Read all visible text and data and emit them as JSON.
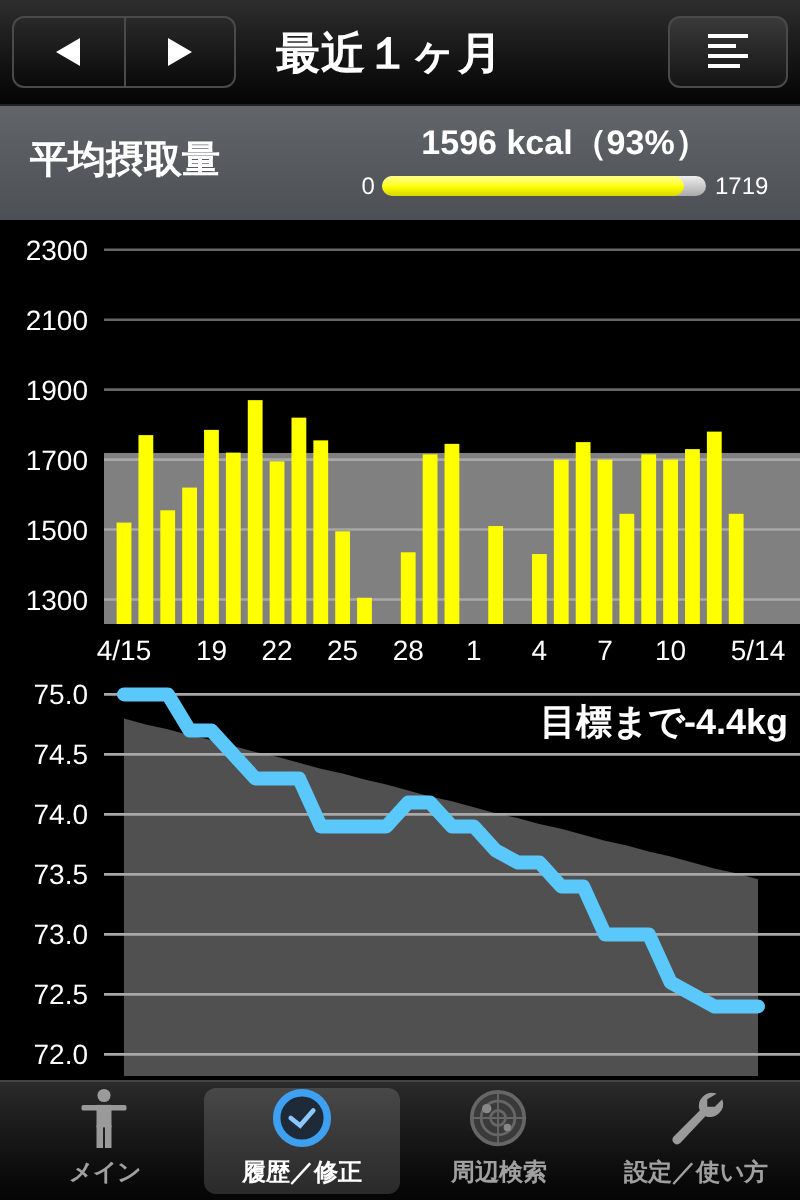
{
  "header": {
    "title": "最近１ヶ月"
  },
  "summary": {
    "label": "平均摂取量",
    "value": "1596 kcal（93%）",
    "min": "0",
    "max": "1719",
    "level": 0.93
  },
  "intake_chart": {
    "chart_data": {
      "type": "bar",
      "categories": [
        "4/15",
        null,
        null,
        null,
        "19",
        null,
        null,
        "22",
        null,
        null,
        "25",
        null,
        null,
        "28",
        null,
        null,
        "1",
        null,
        null,
        "4",
        null,
        null,
        "7",
        null,
        null,
        "10",
        null,
        null,
        null,
        "5/14"
      ],
      "series": [
        {
          "color": "#ffff00",
          "values": [
            1520,
            1770,
            1555,
            1620,
            1785,
            1720,
            1870,
            1695,
            1820,
            1755,
            1495,
            1305,
            null,
            1435,
            1715,
            1745,
            null,
            1510,
            null,
            1430,
            1700,
            1750,
            1700,
            1545,
            1715,
            1700,
            1730,
            1780,
            1545,
            null
          ]
        }
      ],
      "ylim": [
        1230,
        2385
      ],
      "yticks": [
        1300,
        1500,
        1700,
        1900,
        2100,
        2300
      ],
      "grid": true,
      "bands": [
        {
          "axis": "y",
          "from": 1230,
          "to": 1719,
          "color": "#808080"
        }
      ]
    }
  },
  "weight_chart": {
    "goal_text": "目標まで-4.4kg",
    "chart_data": {
      "type": "line",
      "categories": [
        null,
        null,
        null,
        null,
        null,
        null,
        null,
        null,
        null,
        null,
        null,
        null,
        null,
        null,
        null,
        null,
        null,
        null,
        null,
        null,
        null,
        null,
        null,
        null,
        null,
        null,
        null,
        null,
        null,
        null
      ],
      "series": [
        {
          "type": "area",
          "color": "#505050",
          "values": [
            74.8,
            74.75,
            74.71,
            74.66,
            74.62,
            74.57,
            74.52,
            74.48,
            74.43,
            74.38,
            74.34,
            74.29,
            74.25,
            74.2,
            74.15,
            74.11,
            74.06,
            74.01,
            73.97,
            73.92,
            73.88,
            73.83,
            73.78,
            73.74,
            73.69,
            73.65,
            73.6,
            73.55,
            73.51,
            73.46
          ]
        },
        {
          "type": "line",
          "color": "#5ac8fa",
          "values": [
            75.0,
            75.0,
            75.0,
            74.7,
            74.7,
            74.5,
            74.3,
            74.3,
            74.3,
            73.9,
            73.9,
            73.9,
            73.9,
            74.1,
            74.1,
            73.9,
            73.9,
            73.7,
            73.6,
            73.6,
            73.4,
            73.4,
            73.0,
            73.0,
            73.0,
            72.6,
            72.5,
            72.4,
            72.4,
            72.4
          ]
        }
      ],
      "ylim": [
        71.82,
        75.12
      ],
      "yticks": [
        {
          "value": 72,
          "label": "72.0"
        },
        {
          "value": 72.5,
          "label": "72.5"
        },
        {
          "value": 73,
          "label": "73.0"
        },
        {
          "value": 73.5,
          "label": "73.5"
        },
        {
          "value": 74,
          "label": "74.0"
        },
        {
          "value": 74.5,
          "label": "74.5"
        },
        {
          "value": 75,
          "label": "75.0"
        }
      ],
      "grid": true
    }
  },
  "tab_bar": {
    "tabs": [
      {
        "label": "メイン",
        "selected": false
      },
      {
        "label": "履歴／修正",
        "selected": true
      },
      {
        "label": "周辺検索",
        "selected": false
      },
      {
        "label": "設定／使い方",
        "selected": false
      }
    ]
  }
}
